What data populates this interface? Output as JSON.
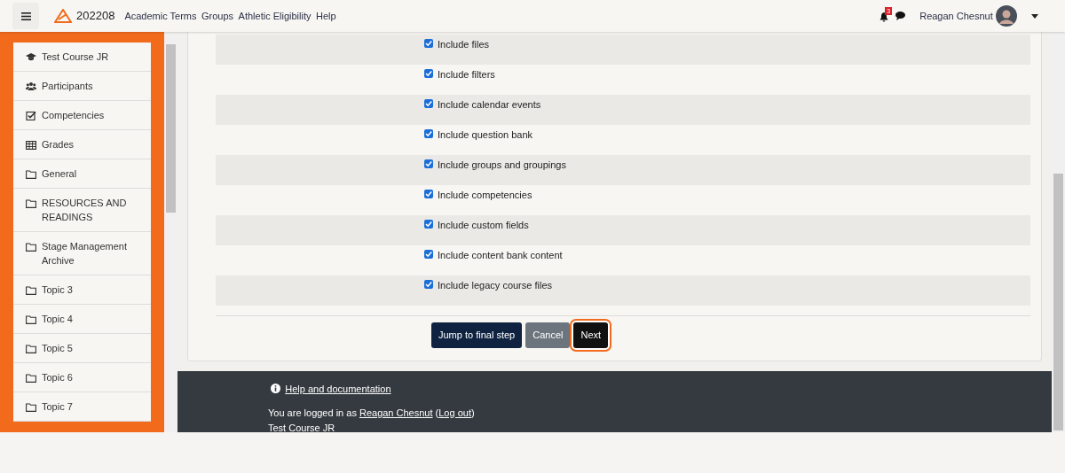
{
  "navbar": {
    "site": "202208",
    "menu": [
      "Academic Terms",
      "Groups",
      "Athletic Eligibility",
      "Help"
    ],
    "notifications": "3",
    "user": "Reagan Chesnut"
  },
  "sidebar": {
    "items": [
      {
        "label": "Test Course JR",
        "kind": "course"
      },
      {
        "label": "Participants",
        "kind": "users"
      },
      {
        "label": "Competencies",
        "kind": "check"
      },
      {
        "label": "Grades",
        "kind": "table"
      },
      {
        "label": "General",
        "kind": "folder"
      },
      {
        "label": "RESOURCES AND READINGS",
        "kind": "folder"
      },
      {
        "label": "Stage Management Archive",
        "kind": "folder"
      },
      {
        "label": "Topic 3",
        "kind": "folder"
      },
      {
        "label": "Topic 4",
        "kind": "folder"
      },
      {
        "label": "Topic 5",
        "kind": "folder"
      },
      {
        "label": "Topic 6",
        "kind": "folder"
      },
      {
        "label": "Topic 7",
        "kind": "folder"
      }
    ]
  },
  "options": [
    {
      "label": "Include files",
      "checked": true
    },
    {
      "label": "Include filters",
      "checked": true
    },
    {
      "label": "Include calendar events",
      "checked": true
    },
    {
      "label": "Include question bank",
      "checked": true
    },
    {
      "label": "Include groups and groupings",
      "checked": true
    },
    {
      "label": "Include competencies",
      "checked": true
    },
    {
      "label": "Include custom fields",
      "checked": true
    },
    {
      "label": "Include content bank content",
      "checked": true
    },
    {
      "label": "Include legacy course files",
      "checked": true
    }
  ],
  "buttons": [
    {
      "label": "Jump to final step",
      "kind": "primary",
      "focused": false
    },
    {
      "label": "Cancel",
      "kind": "secondary",
      "focused": false
    },
    {
      "label": "Next",
      "kind": "dark",
      "focused": true
    }
  ],
  "footer": {
    "help": "Help and documentation",
    "login": [
      {
        "kind": "text",
        "text": "You are logged in as "
      },
      {
        "kind": "link",
        "text": "Reagan Chesnut"
      },
      {
        "kind": "text",
        "text": " ("
      },
      {
        "kind": "link",
        "text": "Log out"
      },
      {
        "kind": "text",
        "text": ")"
      }
    ],
    "course": "Test Course JR"
  }
}
